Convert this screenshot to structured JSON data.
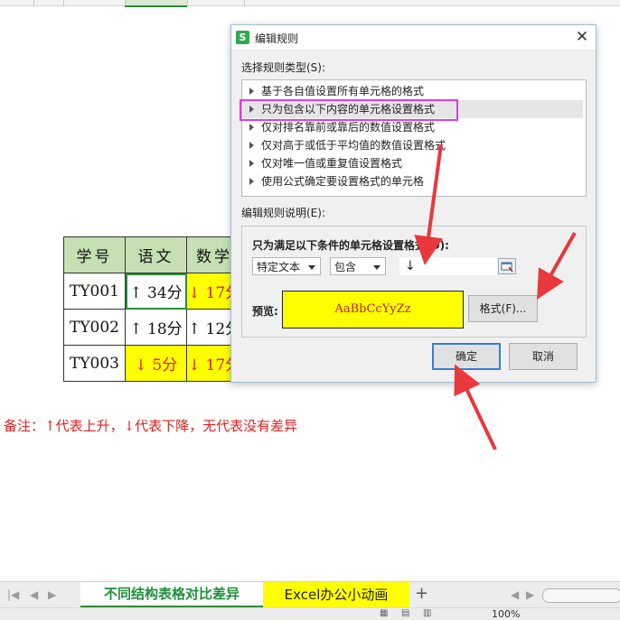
{
  "sheet": {
    "table": {
      "headers": [
        "学号",
        "语文",
        "数学"
      ],
      "rows": [
        {
          "id": "TY001",
          "chinese": "↑ 34分",
          "math": "↓ 17分"
        },
        {
          "id": "TY002",
          "chinese": "↑ 18分",
          "math": "↑ 12分"
        },
        {
          "id": "TY003",
          "chinese": "↓ 5分",
          "math": "↓ 17分"
        }
      ]
    },
    "note": "备注：↑代表上升，↓代表下降，无代表没有差异"
  },
  "dialog": {
    "title": "编辑规则",
    "app_icon": "S",
    "close_glyph": "✕",
    "rule_type_label": "选择规则类型(S):",
    "rule_types": [
      "基于各自值设置所有单元格的格式",
      "只为包含以下内容的单元格设置格式",
      "仅对排名靠前或靠后的数值设置格式",
      "仅对高于或低于平均值的数值设置格式",
      "仅对唯一值或重复值设置格式",
      "使用公式确定要设置格式的单元格"
    ],
    "selected_index": 1,
    "desc_label": "编辑规则说明(E):",
    "condition_heading": "只为满足以下条件的单元格设置格式(O):",
    "combo1": "特定文本",
    "combo2": "包含",
    "value": "↓",
    "preview_label": "预览:",
    "preview_text": "AaBbCcYyZz",
    "format_button": "格式(F)...",
    "ok_button": "确定",
    "cancel_button": "取消"
  },
  "tabs": {
    "sheet1": "不同结构表格对比差异",
    "sheet2": "Excel办公小动画",
    "add": "+"
  },
  "status": {
    "zoom": "100%"
  },
  "colors": {
    "header_green": "#c6e0b4",
    "highlight_yellow": "#ffff00",
    "annotation_red": "#e02020",
    "dialog_highlight": "#e03ce0",
    "active_green": "#2e8b3a"
  },
  "icons": [
    "triangle-right-icon",
    "close-icon",
    "cell-picker-icon",
    "dropdown-arrow-icon",
    "red-arrow-icon"
  ]
}
